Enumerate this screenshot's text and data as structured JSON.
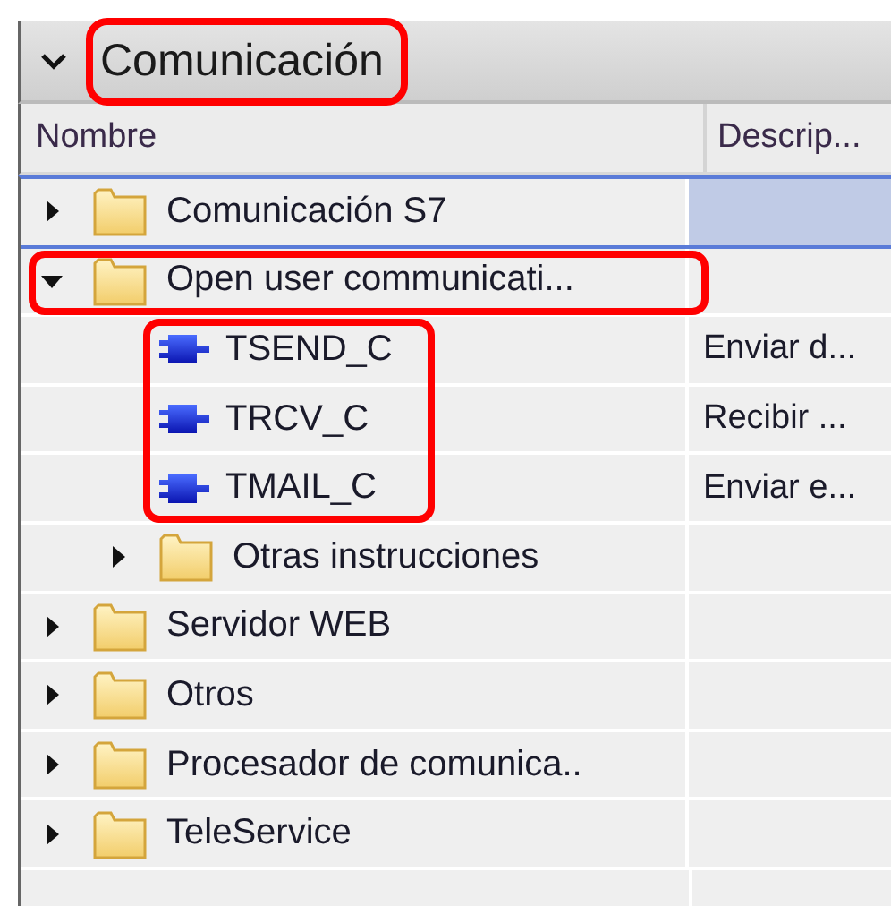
{
  "panel": {
    "title": "Comunicación",
    "expanded": true,
    "highlighted": true
  },
  "columns": [
    "Nombre",
    "Descrip..."
  ],
  "tree": {
    "items": [
      {
        "kind": "folder",
        "name": "Comunicación S7",
        "expanded": false,
        "selected": true,
        "highlighted": false
      },
      {
        "kind": "folder",
        "name": "Open user communicati...",
        "expanded": true,
        "selected": false,
        "highlighted": true,
        "children": [
          {
            "kind": "block",
            "name": "TSEND_C",
            "description": "Enviar d...",
            "selected": false,
            "highlighted": true
          },
          {
            "kind": "block",
            "name": "TRCV_C",
            "description": "Recibir ...",
            "selected": false,
            "highlighted": true
          },
          {
            "kind": "block",
            "name": "TMAIL_C",
            "description": "Enviar e...",
            "selected": false,
            "highlighted": true
          },
          {
            "kind": "folder",
            "name": "Otras instrucciones",
            "expanded": false,
            "selected": false,
            "highlighted": false
          }
        ]
      },
      {
        "kind": "folder",
        "name": "Servidor WEB",
        "expanded": false,
        "selected": false,
        "highlighted": false
      },
      {
        "kind": "folder",
        "name": "Otros",
        "expanded": false,
        "selected": false,
        "highlighted": false
      },
      {
        "kind": "folder",
        "name": "Procesador de comunica..",
        "expanded": false,
        "selected": false,
        "highlighted": false
      },
      {
        "kind": "folder",
        "name": "TeleService",
        "expanded": false,
        "selected": false,
        "highlighted": false
      }
    ]
  }
}
